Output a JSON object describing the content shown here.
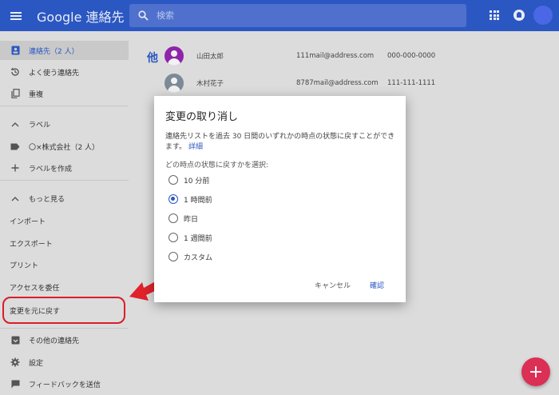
{
  "header": {
    "title": "Google 連絡先",
    "search_placeholder": "検索"
  },
  "sidebar": {
    "items": [
      {
        "label": "連絡先（2 人）",
        "icon": "contacts-icon",
        "active": true
      },
      {
        "label": "よく使う連絡先",
        "icon": "history-icon"
      },
      {
        "label": "重複",
        "icon": "duplicate-icon"
      },
      {
        "label": "ラベル",
        "icon": "chevron-up-icon"
      },
      {
        "label": "〇×株式会社（2 人）",
        "icon": "label-icon"
      },
      {
        "label": "ラベルを作成",
        "icon": "add-icon"
      },
      {
        "label": "もっと見る",
        "icon": "chevron-up-icon"
      },
      {
        "label": "インポート"
      },
      {
        "label": "エクスポート"
      },
      {
        "label": "プリント"
      },
      {
        "label": "アクセスを委任"
      },
      {
        "label": "変更を元に戻す",
        "highlighted": true
      },
      {
        "label": "その他の連絡先",
        "icon": "archive-icon"
      },
      {
        "label": "設定",
        "icon": "gear-icon"
      },
      {
        "label": "フィードバックを送信",
        "icon": "feedback-icon"
      }
    ]
  },
  "contacts": {
    "group_letter": "他",
    "rows": [
      {
        "name": "山田太郎",
        "email": "111mail@address.com",
        "phone": "000-000-0000",
        "avatar_color": "#8e24aa"
      },
      {
        "name": "木村花子",
        "email": "8787mail@address.com",
        "phone": "111-111-1111",
        "avatar_color": "#7b8a96"
      }
    ]
  },
  "dialog": {
    "title": "変更の取り消し",
    "description": "連絡先リストを過去 30 日間のいずれかの時点の状態に戻すことができます。",
    "details_link": "詳細",
    "prompt": "どの時点の状態に戻すかを選択:",
    "options": [
      {
        "label": "10 分前",
        "checked": false
      },
      {
        "label": "1 時間前",
        "checked": true
      },
      {
        "label": "昨日",
        "checked": false
      },
      {
        "label": "1 週間前",
        "checked": false
      },
      {
        "label": "カスタム",
        "checked": false
      }
    ],
    "cancel_label": "キャンセル",
    "confirm_label": "確認"
  },
  "fab": {
    "label": "+"
  },
  "colors": {
    "header_bg": "#2b57c2",
    "accent": "#2b57c2",
    "fab": "#dc2f55",
    "highlight_border": "#d81e2a"
  }
}
